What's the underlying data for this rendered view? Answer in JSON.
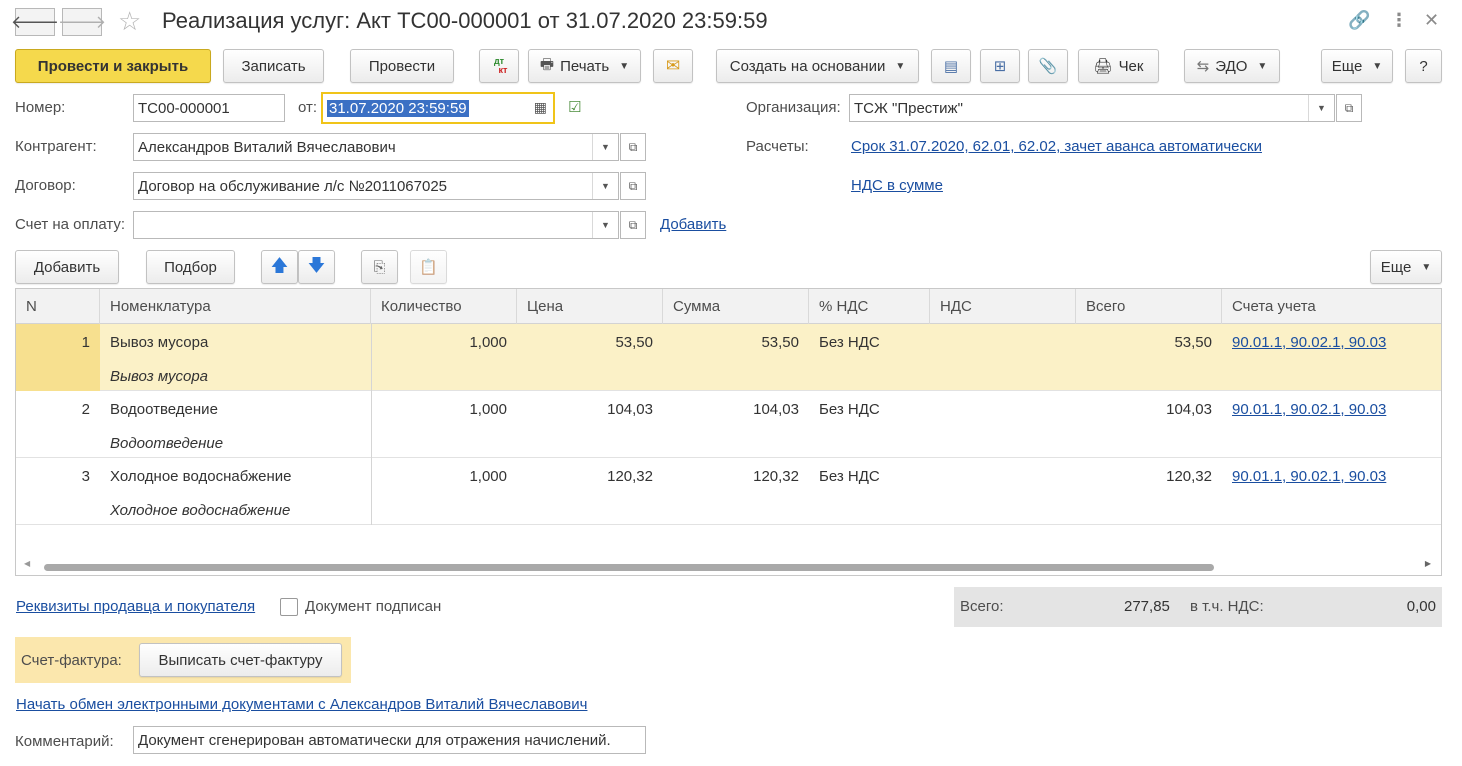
{
  "window": {
    "title": "Реализация услуг: Акт ТС00-000001 от 31.07.2020 23:59:59"
  },
  "toolbar": {
    "post_close": "Провести и закрыть",
    "save": "Записать",
    "post": "Провести",
    "dtkt_top": "дт",
    "dtkt_bottom": "кт",
    "print": "Печать",
    "create_based": "Создать на основании",
    "receipt": "Чек",
    "edo": "ЭДО",
    "more": "Еще",
    "help": "?"
  },
  "form": {
    "number_label": "Номер:",
    "number_value": "ТС00-000001",
    "date_label": "от:",
    "date_value": "31.07.2020 23:59:59",
    "org_label": "Организация:",
    "org_value": "ТСЖ \"Престиж\"",
    "counterparty_label": "Контрагент:",
    "counterparty_value": "Александров Виталий Вячеславович",
    "settlements_label": "Расчеты:",
    "settlements_link": "Срок 31.07.2020, 62.01, 62.02, зачет аванса автоматически",
    "vat_link": "НДС в сумме",
    "contract_label": "Договор:",
    "contract_value": "Договор на обслуживание л/с №2011067025",
    "invoice_label": "Счет на оплату:",
    "invoice_value": "",
    "add_link": "Добавить"
  },
  "table_toolbar": {
    "add": "Добавить",
    "pick": "Подбор",
    "more": "Еще"
  },
  "table": {
    "headers": [
      "N",
      "Номенклатура",
      "Количество",
      "Цена",
      "Сумма",
      "% НДС",
      "НДС",
      "Всего",
      "Счета учета"
    ],
    "rows": [
      {
        "n": "1",
        "name": "Вывоз мусора",
        "name2": "Вывоз мусора",
        "qty": "1,000",
        "price": "53,50",
        "sum": "53,50",
        "vat_rate": "Без НДС",
        "vat": "",
        "total": "53,50",
        "accounts": "90.01.1, 90.02.1, 90.03"
      },
      {
        "n": "2",
        "name": "Водоотведение",
        "name2": "Водоотведение",
        "qty": "1,000",
        "price": "104,03",
        "sum": "104,03",
        "vat_rate": "Без НДС",
        "vat": "",
        "total": "104,03",
        "accounts": "90.01.1, 90.02.1, 90.03"
      },
      {
        "n": "3",
        "name": "Холодное водоснабжение",
        "name2": "Холодное водоснабжение",
        "qty": "1,000",
        "price": "120,32",
        "sum": "120,32",
        "vat_rate": "Без НДС",
        "vat": "",
        "total": "120,32",
        "accounts": "90.01.1, 90.02.1, 90.03"
      }
    ]
  },
  "footer": {
    "requisites_link": "Реквизиты продавца и покупателя",
    "signed_label": "Документ подписан",
    "total_label": "Всего:",
    "total_value": "277,85",
    "vat_label": "в т.ч. НДС:",
    "vat_value": "0,00",
    "invoice_label": "Счет-фактура:",
    "invoice_button": "Выписать счет-фактуру",
    "edo_link": "Начать обмен электронными документами с Александров Виталий Вячеславович",
    "comment_label": "Комментарий:",
    "comment_value": "Документ сгенерирован автоматически для отражения начислений."
  },
  "colors": {
    "primary_button": "#f5d94c",
    "link": "#1a4ea0",
    "selected_row": "#fbf1c7",
    "focus_border": "#f0c419"
  }
}
